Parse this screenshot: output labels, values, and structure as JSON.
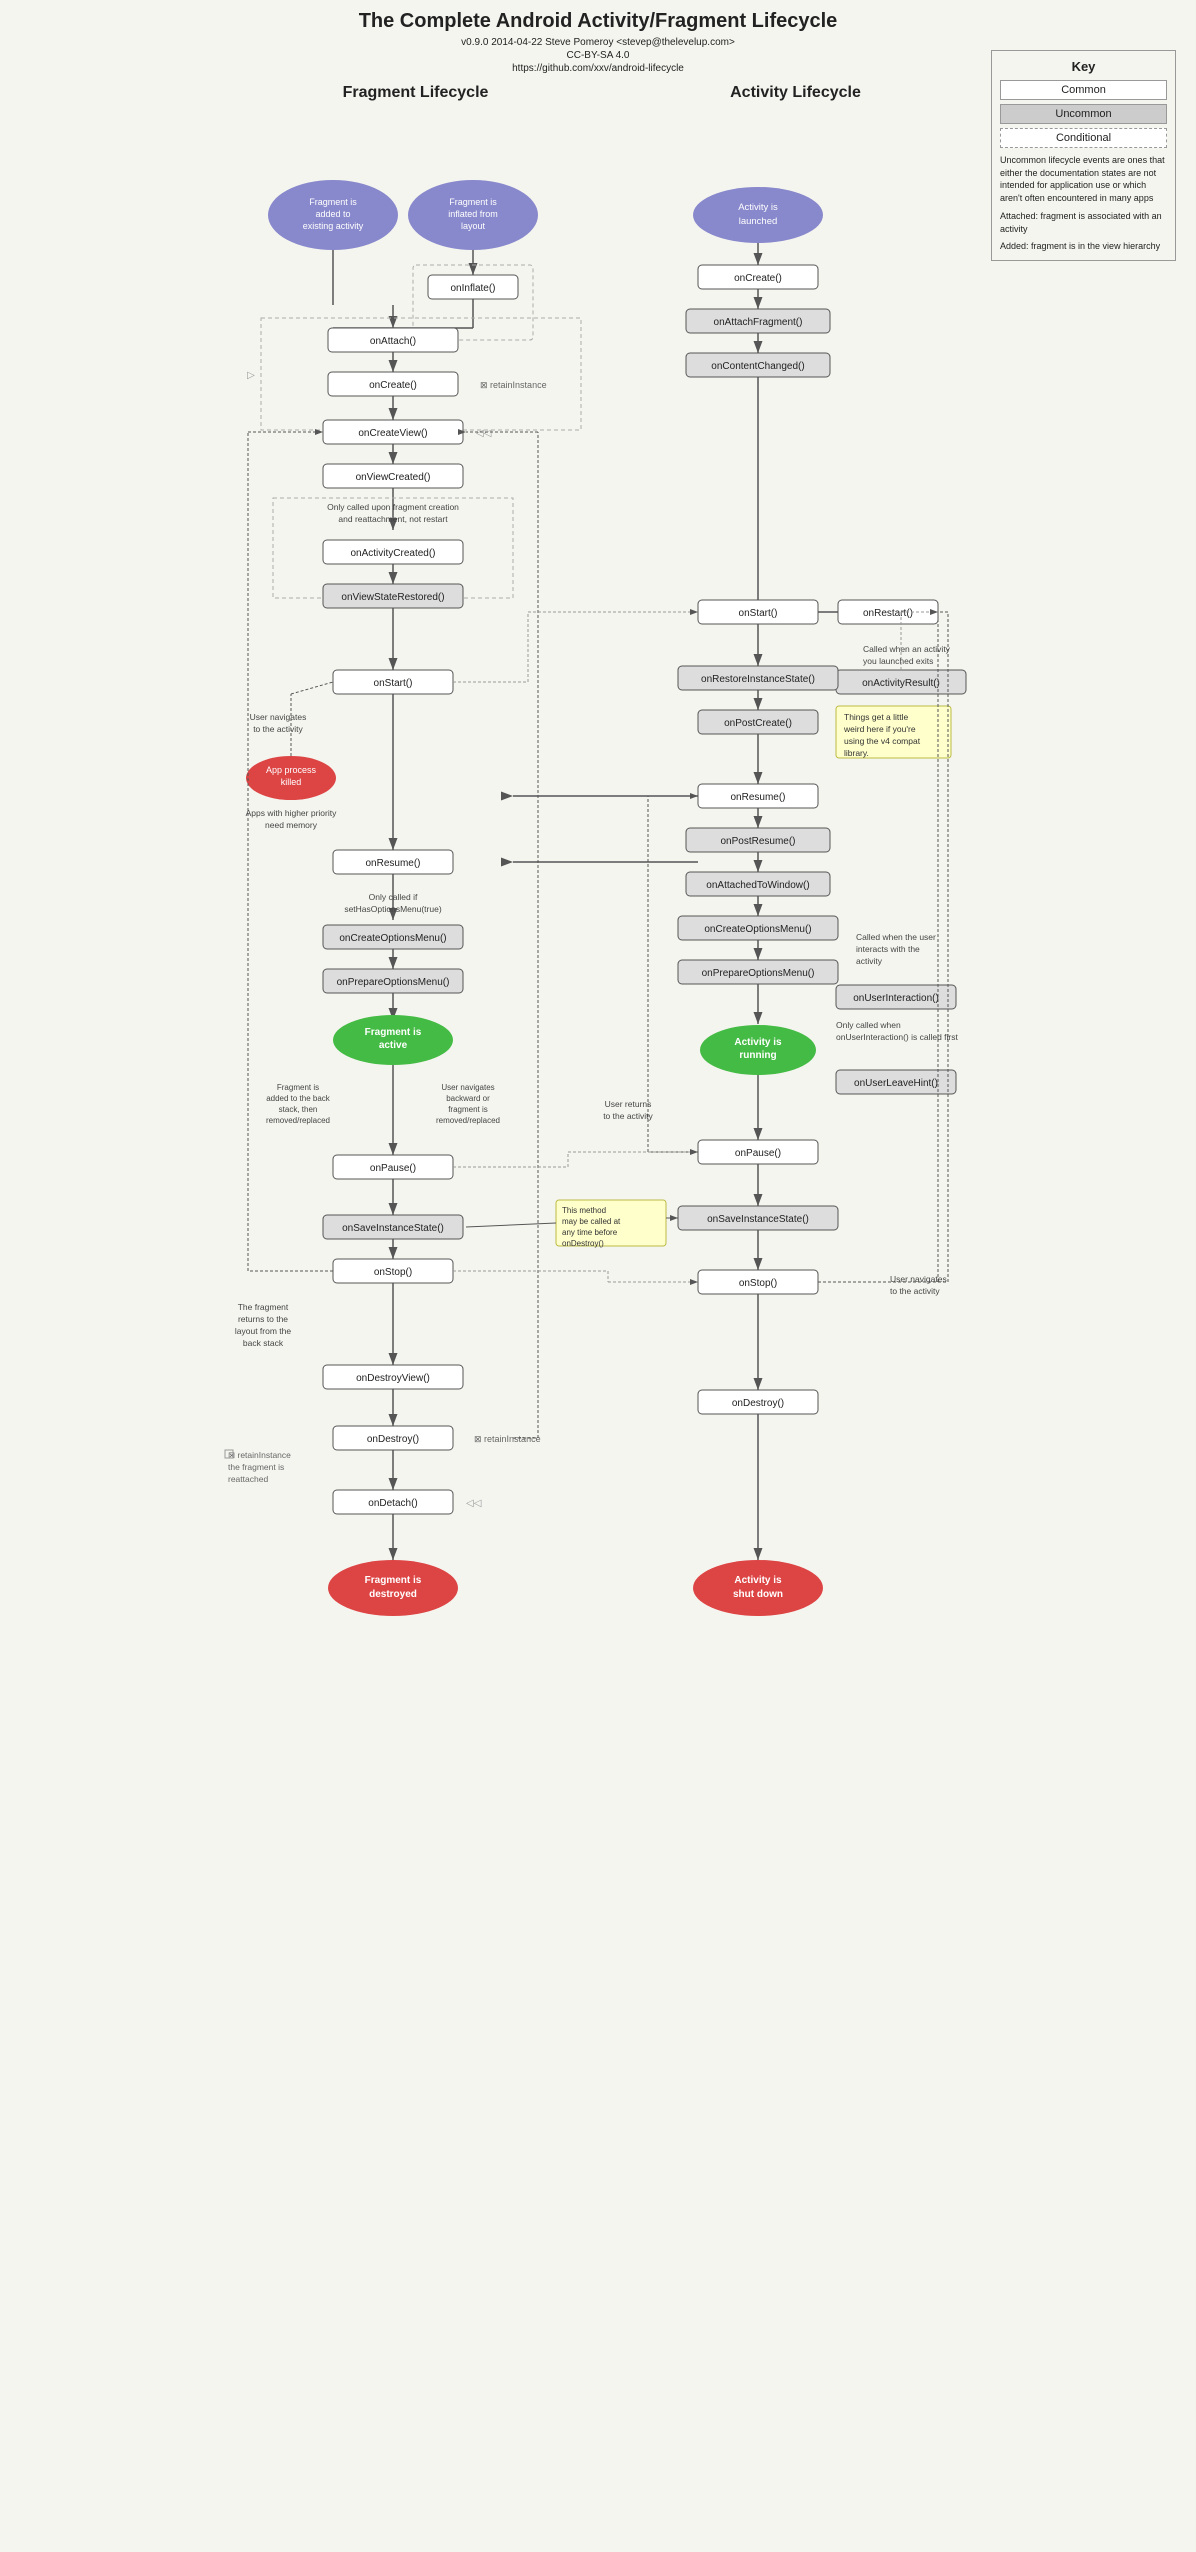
{
  "title": "The Complete Android Activity/Fragment Lifecycle",
  "subtitle": "v0.9.0 2014-04-22 Steve Pomeroy <stevep@thelevelup.com>",
  "subtitle2": "CC-BY-SA 4.0",
  "subtitle3": "https://github.com/xxv/android-lifecycle",
  "key": {
    "title": "Key",
    "items": [
      {
        "label": "Common",
        "type": "common"
      },
      {
        "label": "Uncommon",
        "type": "uncommon"
      },
      {
        "label": "Conditional",
        "type": "conditional"
      }
    ],
    "description1": "Uncommon lifecycle events are ones that either the documentation states are not intended for application use or which aren't often encountered in many apps",
    "description2": "Attached: fragment is associated with an activity",
    "description3": "Added: fragment is in the view hierarchy"
  },
  "fragment_header": "Fragment Lifecycle",
  "activity_header": "Activity Lifecycle",
  "fragment_nodes": {
    "start1": "Fragment is\nadded to\nexisting activity",
    "start2": "Fragment is\ninflated from\nlayout",
    "onInflate": "onInflate()",
    "onAttach": "onAttach()",
    "onCreate": "onCreate()",
    "retainInstance1": "⊠ retainInstance",
    "onCreateView": "onCreateView()",
    "onViewCreated": "onViewCreated()",
    "note_only_called": "Only called upon fragment creation\nand reattachment, not restart",
    "onActivityCreated": "onActivityCreated()",
    "onViewStateRestored": "onViewStateRestored()",
    "onStart": "onStart()",
    "note_user_navigates": "User navigates\nto the activity",
    "appProcessKilled": "App process\nkilled",
    "note_apps_higher": "Apps with higher priority\nneed memory",
    "onResume": "onResume()",
    "note_only_if": "Only called if\nsetHasOptionsMenu(true)",
    "onCreateOptionsMenu": "onCreateOptionsMenu()",
    "onPrepareOptionsMenu": "onPrepareOptionsMenu()",
    "fragmentIsActive": "Fragment is\nactive",
    "note_fragment_added_back": "Fragment is\nadded to the back\nstack, then\nremoved/replaced",
    "note_user_navigates_backward": "User navigates\nbackward or\nfragment is\nremoved/replaced",
    "onPause": "onPause()",
    "onSaveInstanceState": "onSaveInstanceState()",
    "onStop": "onStop()",
    "note_fragment_returns": "The fragment\nreturns to the\nlayout from the\nback stack",
    "onDestroyView": "onDestroyView()",
    "onDestroy": "onDestroy()",
    "retainInstance2": "⊠ retainInstance\nthe fragment is\nreattached",
    "onDetach": "onDetach()",
    "fragmentIsDestroyed": "Fragment is\ndestroyed"
  },
  "activity_nodes": {
    "activityLaunched": "Activity is\nlaunched",
    "onCreate": "onCreate()",
    "onAttachFragment": "onAttachFragment()",
    "onContentChanged": "onContentChanged()",
    "onRestart": "onRestart()",
    "onStart": "onStart()",
    "onActivityResult": "onActivityResult()",
    "note_called_when": "Called when an activity\nyou launched exits",
    "onRestoreInstanceState": "onRestoreInstanceState()",
    "onPostCreate": "onPostCreate()",
    "note_things_get": "Things get a little\nweird here if you're\nusing the v4 compat\nlibrary.",
    "onResume": "onResume()",
    "onPostResume": "onPostResume()",
    "onAttachedToWindow": "onAttachedToWindow()",
    "onCreateOptionsMenu": "onCreateOptionsMenu()",
    "note_called_when_user": "Called when the user\ninteracts with the\nactivity",
    "onPrepareOptionsMenu": "onPrepareOptionsMenu()",
    "onUserInteraction": "onUserInteraction()",
    "note_only_called_when": "Only called when\nonUserInteraction() is called first",
    "activityIsRunning": "Activity is\nrunning",
    "onUserLeaveHint": "onUserLeaveHint()",
    "note_user_returns": "User returns\nto the activity",
    "onPause": "onPause()",
    "onSaveInstanceState": "onSaveInstanceState()",
    "note_this_method": "This method\nmay be called at\nany time before\nonDestroy()",
    "onStop": "onStop()",
    "note_user_navigates": "User navigates\nto the activity",
    "onDestroy": "onDestroy()",
    "activityShutDown": "Activity is\nshut down"
  }
}
